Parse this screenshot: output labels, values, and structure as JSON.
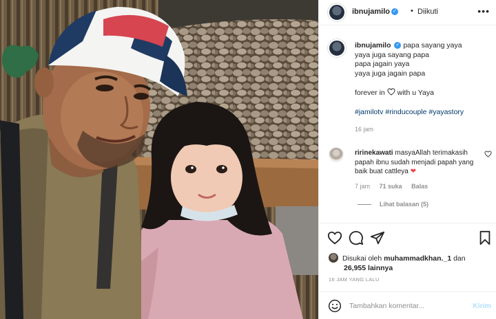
{
  "post": {
    "username": "ibnujamilo",
    "verified_badge": "✓",
    "separator": "•",
    "follow_status": "Diikuti",
    "more_label": "•••"
  },
  "caption": {
    "username": "ibnujamilo",
    "lines": [
      "papa sayang yaya",
      "yaya juga sayang papa",
      "papa jagain yaya",
      "yaya juga jagain papa"
    ],
    "forever_prefix": "forever in",
    "forever_suffix": "with u Yaya",
    "hashtags": "#jamilotv #rinducouple #yayastory",
    "time": "16 jam"
  },
  "comment": {
    "username": "ririnekawati",
    "text": "masyaAllah terimakasih papah ibnu sudah menjadi papah yang baik buat cattleya",
    "emoji": "❤",
    "time": "7 jam",
    "likes": "71 suka",
    "reply_label": "Balas",
    "view_replies": "Lihat balasan (5)"
  },
  "likes": {
    "prefix": "Disukai oleh",
    "user": "muhammadkhan._1",
    "conj": "dan",
    "count": "26,955",
    "suffix": "lainnya"
  },
  "date": "16 JAM YANG LALU",
  "add_comment": {
    "placeholder": "Tambahkan komentar...",
    "send_label": "Kirim"
  },
  "icons": [
    "heart-icon",
    "comment-icon",
    "share-icon",
    "bookmark-icon",
    "emoji-icon",
    "more-icon"
  ],
  "colors": {
    "link": "#00376b",
    "verified": "#3897f0",
    "muted": "#8e8e8e",
    "send_disabled": "#b2dffc",
    "heart_red": "#ed4956"
  }
}
